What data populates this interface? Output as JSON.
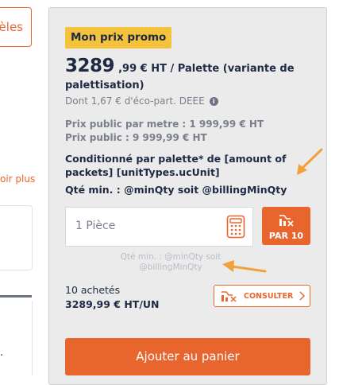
{
  "left": {
    "button_label": "èles",
    "link_label": "oir plus",
    "dot": "."
  },
  "promo": {
    "badge": "Mon prix promo",
    "price_int": "3289",
    "price_rest": ",99 € HT / Palette (variante de palettisation)",
    "eco_part": "Dont 1,67 € d'éco-part. DEEE",
    "info_icon_text": "i",
    "public_metre": "Prix public par metre : 1 999,99 € HT",
    "public_price": "Prix public : 9 999,99 € HT",
    "conditioning": "Conditionné par palette* de [amount of packets] [unitTypes.ucUnit]",
    "min_qty": "Qté min. : @minQty soit @billingMinQty"
  },
  "quantity": {
    "placeholder": "1 Pièce",
    "par_label": "PAR 10",
    "hint": "Qté min. : @minQty soit @billingMinQty"
  },
  "purchases": {
    "count": "10 achetés",
    "price": "3289,99 € HT/UN",
    "consult_label": "CONSULTER"
  },
  "cart": {
    "add_label": "Ajouter au panier"
  },
  "colors": {
    "accent": "#e8662e",
    "badge": "#f5c23c",
    "text": "#1e2a44",
    "muted": "#7a7f8c",
    "panel": "#ebebeb"
  },
  "icons": {
    "calculator": "calculator-icon",
    "price_drop": "price-drop-icon",
    "chevron": "chevron-right-icon",
    "info": "info-icon",
    "arrows": "annotation-arrow"
  }
}
